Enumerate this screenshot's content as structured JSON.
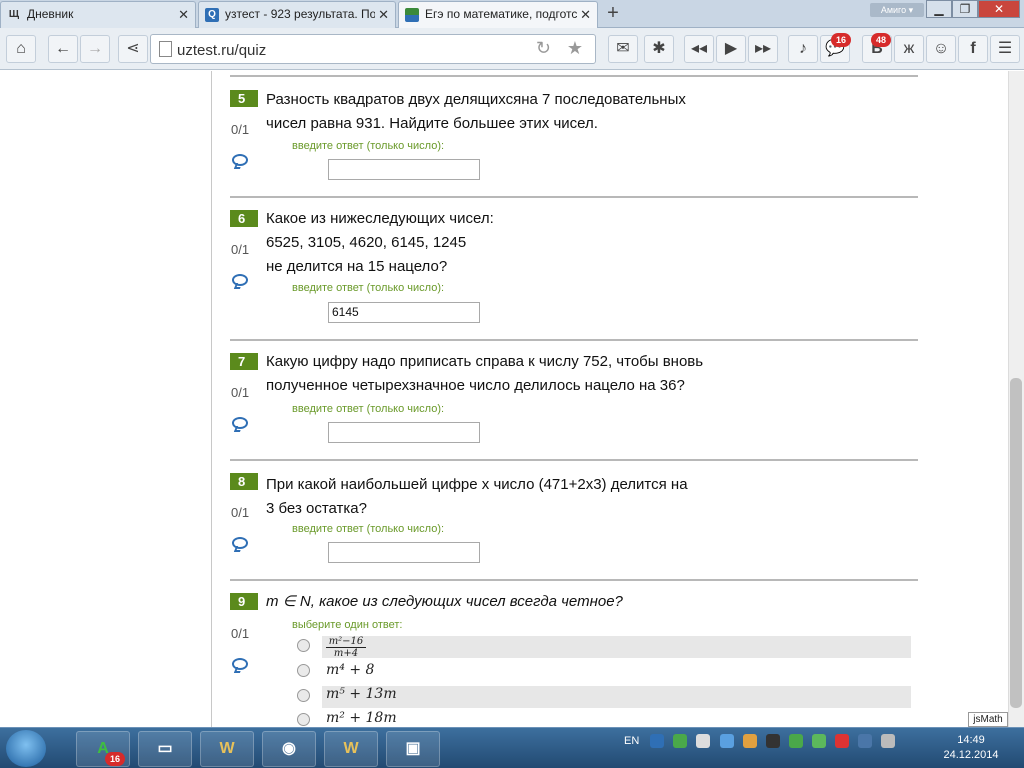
{
  "browser": {
    "tabs": [
      {
        "title": "Дневник",
        "favicon": "Щ",
        "active": false
      },
      {
        "title": "узтест - 923 результата. Поі",
        "favicon": "Q",
        "active": false
      },
      {
        "title": "Егэ по математике, подготс",
        "favicon": "",
        "active": true
      }
    ],
    "new_tab_label": "+",
    "profile_label": "Амиго ▾",
    "address_url": "uztest.ru/quiz",
    "badges": {
      "messages": "16",
      "vk": "48"
    }
  },
  "quiz": {
    "answer_hint": "введите ответ (только число):",
    "choice_hint": "выберите один ответ:",
    "questions": [
      {
        "number": "5",
        "score": "0/1",
        "lines": [
          "Разность квадратов двух делящихсяна 7 последовательных",
          "чисел равна 931. Найдите большее этих чисел."
        ],
        "answer": ""
      },
      {
        "number": "6",
        "score": "0/1",
        "lines": [
          "Какое из нижеследующих чисел:",
          "6525, 3105, 4620, 6145, 1245",
          " не делится на 15 нацело?"
        ],
        "answer": "6145"
      },
      {
        "number": "7",
        "score": "0/1",
        "lines": [
          "Какую цифру надо приписать справа к числу 752, чтобы вновь",
          "полученное четырехзначное число делилось нацело на 36?"
        ],
        "answer": ""
      },
      {
        "number": "8",
        "score": "0/1",
        "lines": [
          "При какой наибольшей цифре  x  число  (471+2x3) делится на",
          "3  без остатка?"
        ],
        "answer": ""
      },
      {
        "number": "9",
        "score": "0/1",
        "lines": [
          "m ∈ N, какое из следующих чисел всегда четное?"
        ],
        "options": [
          {
            "num": "m²−16",
            "den": "m+4"
          },
          {
            "text": "m⁴ + 8"
          },
          {
            "text": "m⁵ + 13m"
          },
          {
            "text": "m² + 18m"
          }
        ]
      }
    ]
  },
  "jsmath_label": "jsMath",
  "taskbar": {
    "language": "EN",
    "time": "14:49",
    "date": "24.12.2014",
    "pinned_badge": "16"
  }
}
